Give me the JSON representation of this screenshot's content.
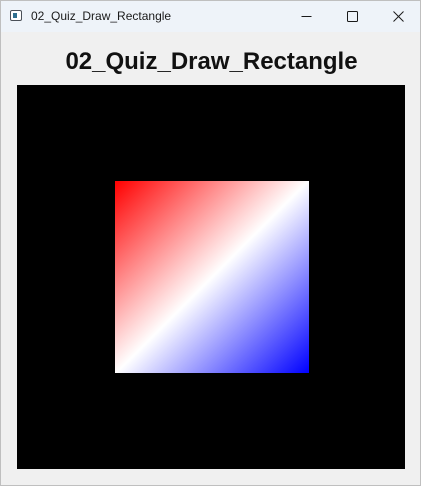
{
  "window": {
    "title": "02_Quiz_Draw_Rectangle",
    "icon": "app-window-icon",
    "controls": {
      "minimize_icon": "minimize-icon",
      "maximize_icon": "maximize-icon",
      "close_icon": "close-icon"
    }
  },
  "content": {
    "heading": "02_Quiz_Draw_Rectangle"
  },
  "canvas": {
    "background": "#000000",
    "rectangle": {
      "gradient_colors": [
        "#ff0000",
        "#ffffff",
        "#0000ff"
      ],
      "gradient_direction": "top-left to bottom-right"
    }
  }
}
